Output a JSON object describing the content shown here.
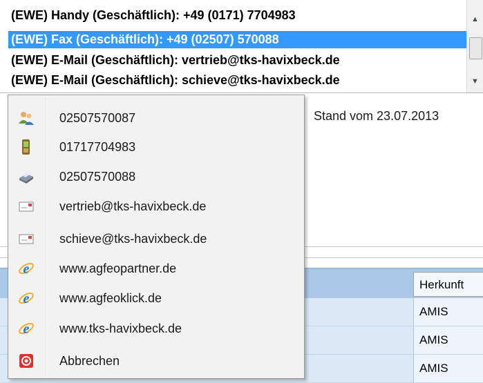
{
  "listbox": {
    "items": [
      "(EWE)  Handy (Geschäftlich): +49 (0171) 7704983",
      "(EWE)  Fax (Geschäftlich): +49 (02507) 570088",
      "(EWE)  E-Mail (Geschäftlich): vertrieb@tks-havixbeck.de",
      "(EWE)  E-Mail (Geschäftlich): schieve@tks-havixbeck.de"
    ],
    "selected_index": 1
  },
  "background": {
    "stand": "Stand vom 23.07.2013",
    "grid_header": "Herkunft",
    "grid_cells": [
      "AMIS",
      "AMIS",
      "AMIS"
    ]
  },
  "context_menu": {
    "items": [
      {
        "label": "02507570087",
        "icon": "contacts-icon"
      },
      {
        "label": "01717704983",
        "icon": "mobile-phone-icon"
      },
      {
        "label": "02507570088",
        "icon": "fax-icon"
      },
      {
        "label": "vertrieb@tks-havixbeck.de",
        "icon": "email-icon"
      },
      {
        "label": "schieve@tks-havixbeck.de",
        "icon": "email-icon"
      },
      {
        "label": "www.agfeopartner.de",
        "icon": "internet-explorer-icon"
      },
      {
        "label": "www.agfeoklick.de",
        "icon": "internet-explorer-icon"
      },
      {
        "label": "www.tks-havixbeck.de",
        "icon": "internet-explorer-icon"
      },
      {
        "label": "Abbrechen",
        "icon": "cancel-icon"
      }
    ]
  },
  "colors": {
    "selection": "#3399ff",
    "grid_header": "#a9c8e8",
    "grid_row": "#dbe9f7",
    "menu_bg": "#f2f2f2",
    "cancel_red": "#d9342b"
  }
}
